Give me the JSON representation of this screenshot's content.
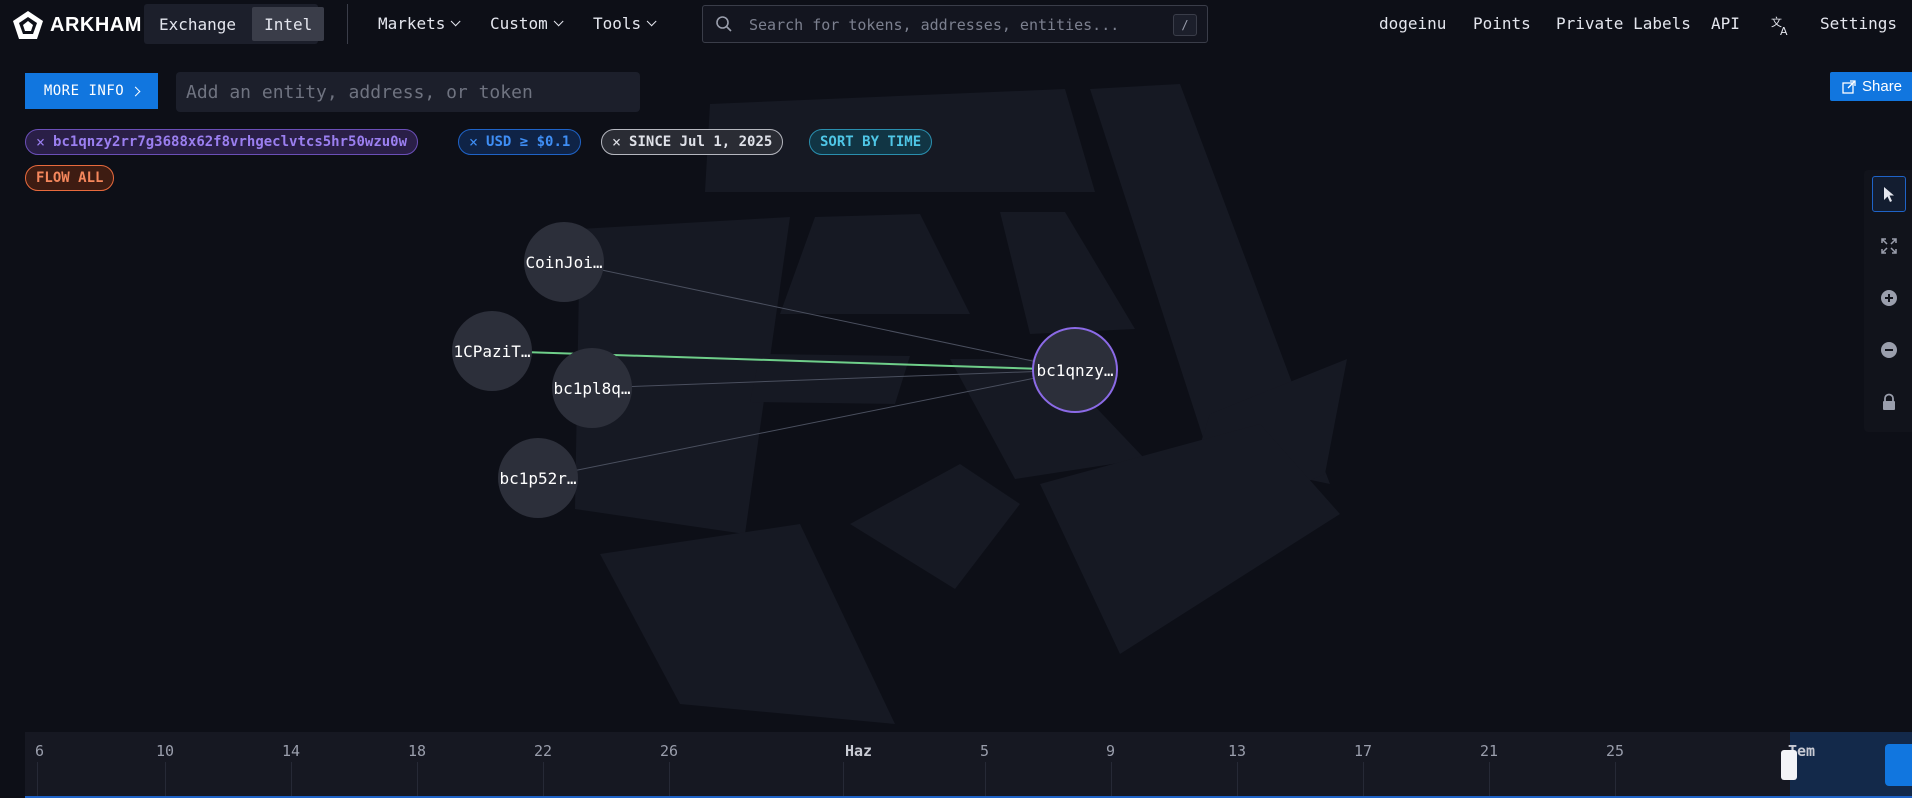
{
  "app": {
    "brand": "ARKHAM",
    "mode_tabs": [
      "Exchange",
      "Intel"
    ],
    "active_mode": "Intel"
  },
  "nav": {
    "menus": [
      "Markets",
      "Custom",
      "Tools"
    ],
    "search_placeholder": "Search for tokens, addresses, entities...",
    "search_shortcut": "/",
    "right_links": [
      "dogeinu",
      "Points",
      "Private Labels",
      "API",
      "Settings"
    ],
    "translate_icon": "translate-icon"
  },
  "controls": {
    "more_info_label": "MORE INFO",
    "entity_placeholder": "Add an entity, address, or token",
    "share_label": "Share"
  },
  "filters": {
    "address": "bc1qnzy2rr7g3688x62f8vrhgeclvtcs5hr50wzu0w",
    "usd": "USD ≥ $0.1",
    "since": "SINCE Jul 1, 2025",
    "sort": "SORT BY TIME",
    "flow": "FLOW ALL",
    "remove_glyph": "×"
  },
  "graph": {
    "nodes": [
      {
        "id": "coinjoin",
        "label": "CoinJoi…"
      },
      {
        "id": "1cpazi",
        "label": "1CPaziT…"
      },
      {
        "id": "bc1pl8q",
        "label": "bc1pl8q…"
      },
      {
        "id": "bc1p52r",
        "label": "bc1p52r…"
      },
      {
        "id": "main",
        "label": "bc1qnzy…"
      }
    ],
    "edges": [
      {
        "from": "coinjoin",
        "to": "main",
        "color": "#4a4f5e"
      },
      {
        "from": "1cpazi",
        "to": "main",
        "color": "#6fcf8a"
      },
      {
        "from": "bc1pl8q",
        "to": "main",
        "color": "#4a4f5e"
      },
      {
        "from": "bc1p52r",
        "to": "main",
        "color": "#4a4f5e"
      }
    ],
    "selected_node_color": "#8b6ae6"
  },
  "toolbar": {
    "tools": [
      "pointer-icon",
      "fit-view-icon",
      "zoom-in-icon",
      "zoom-out-icon",
      "lock-icon"
    ]
  },
  "timeline": {
    "ticks": [
      "6",
      "10",
      "14",
      "18",
      "22",
      "26",
      "Haz",
      "5",
      "9",
      "13",
      "17",
      "21",
      "25",
      "Tem"
    ]
  },
  "colors": {
    "accent": "#1176df",
    "background": "#0d0f17"
  }
}
